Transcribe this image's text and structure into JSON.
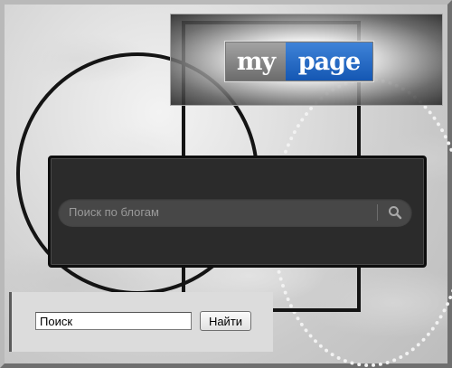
{
  "logo": {
    "part1": "my",
    "part2": "page"
  },
  "blog_search": {
    "placeholder": "Поиск по блогам",
    "icon": "search-icon"
  },
  "site_search": {
    "value": "Поиск",
    "button_label": "Найти"
  },
  "colors": {
    "logo_gray": "#8a8a8a",
    "logo_blue": "#1f6bc6",
    "panel_dark": "#2b2b2b",
    "search_field": "#474747"
  }
}
